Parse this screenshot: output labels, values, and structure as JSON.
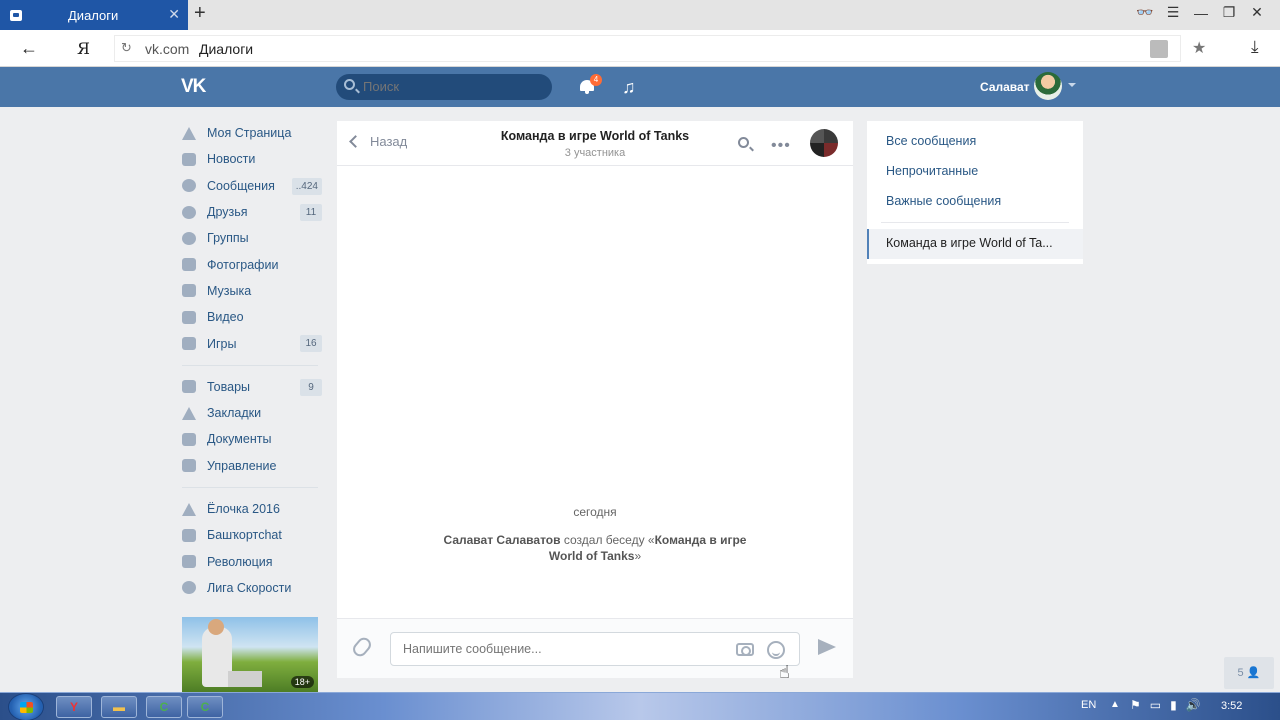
{
  "browser": {
    "tab_title": "Диалоги",
    "tab_close": "✕",
    "new_tab": "+",
    "url_domain": "vk.com",
    "url_path": "Диалоги",
    "yandex_logo": "Я"
  },
  "header": {
    "search_placeholder": "Поиск",
    "notifications_count": "4",
    "user_name": "Салават",
    "brand_color": "#4a76a8"
  },
  "sidebar": {
    "items": [
      {
        "label": "Моя Страница",
        "count": ""
      },
      {
        "label": "Новости",
        "count": ""
      },
      {
        "label": "Сообщения",
        "count": "..424"
      },
      {
        "label": "Друзья",
        "count": "11"
      },
      {
        "label": "Группы",
        "count": ""
      },
      {
        "label": "Фотографии",
        "count": ""
      },
      {
        "label": "Музыка",
        "count": ""
      },
      {
        "label": "Видео",
        "count": ""
      },
      {
        "label": "Игры",
        "count": "16"
      }
    ],
    "items2": [
      {
        "label": "Товары",
        "count": "9"
      },
      {
        "label": "Закладки",
        "count": ""
      },
      {
        "label": "Документы",
        "count": ""
      },
      {
        "label": "Управление",
        "count": ""
      }
    ],
    "apps": [
      {
        "label": "Ёлочка 2016"
      },
      {
        "label": "Башҡортchat"
      },
      {
        "label": "Революция"
      },
      {
        "label": "Лига Скорости"
      }
    ],
    "promo_badge": "18+"
  },
  "chat": {
    "back_label": "Назад",
    "title": "Команда в игре World of Tanks",
    "subtitle": "3 участника",
    "day_label": "сегодня",
    "service_author": "Салават Салаватов",
    "service_action": " создал беседу «",
    "service_chat_name": "Команда в игре World of Tanks",
    "service_end": "»",
    "compose_placeholder": "Напишите сообщение..."
  },
  "filters": {
    "all": "Все сообщения",
    "unread": "Непрочитанные",
    "important": "Важные сообщения",
    "active_chat": "Команда в игре World of Ta..."
  },
  "widget": {
    "count": "5"
  },
  "taskbar": {
    "lang": "EN",
    "time": "3:52"
  }
}
